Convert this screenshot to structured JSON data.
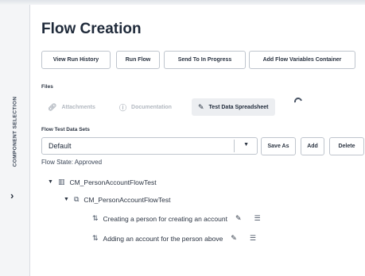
{
  "side_rail": {
    "label": "COMPONENT SELECTION",
    "chevron": "›"
  },
  "title": "Flow Creation",
  "toolbar": {
    "view_run_history": "View Run History",
    "run_flow": "Run Flow",
    "send_to_in_progress": "Send To In Progress",
    "add_flow_variables_container": "Add Flow Variables Container"
  },
  "files": {
    "label": "Files",
    "tabs": [
      {
        "label": "Attachments",
        "icon": "paperclip-icon",
        "active": false
      },
      {
        "label": "Documentation",
        "icon": "info-icon",
        "active": false
      },
      {
        "label": "Test Data Spreadsheet",
        "icon": "pencil-icon",
        "active": true
      }
    ]
  },
  "test_data_sets": {
    "label": "Flow Test Data Sets",
    "selected": "Default",
    "save_as": "Save As",
    "add": "Add",
    "delete": "Delete"
  },
  "flow_state": "Flow State: Approved",
  "tree": {
    "root": "CM_PersonAccountFlowTest",
    "child": "CM_PersonAccountFlowTest",
    "steps": [
      "Creating a person for creating an account",
      "Adding an account for the person above"
    ]
  }
}
